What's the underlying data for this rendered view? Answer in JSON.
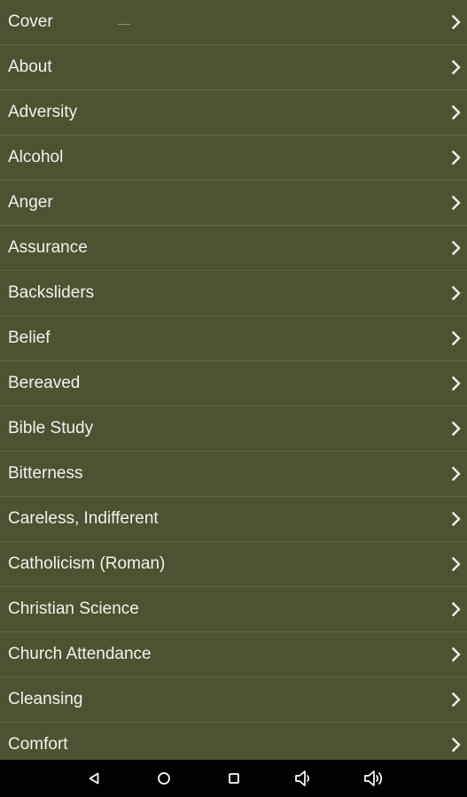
{
  "topics": [
    {
      "label": "Cover"
    },
    {
      "label": "About"
    },
    {
      "label": "Adversity"
    },
    {
      "label": "Alcohol"
    },
    {
      "label": "Anger"
    },
    {
      "label": "Assurance"
    },
    {
      "label": "Backsliders"
    },
    {
      "label": "Belief"
    },
    {
      "label": "Bereaved"
    },
    {
      "label": "Bible Study"
    },
    {
      "label": "Bitterness"
    },
    {
      "label": "Careless, Indifferent"
    },
    {
      "label": "Catholicism (Roman)"
    },
    {
      "label": "Christian Science"
    },
    {
      "label": "Church Attendance"
    },
    {
      "label": "Cleansing"
    },
    {
      "label": "Comfort"
    }
  ],
  "row_icon": "chevron-right-icon",
  "nav_bar": {
    "buttons": [
      {
        "icon": "back-triangle-icon"
      },
      {
        "icon": "home-circle-icon"
      },
      {
        "icon": "recents-square-icon"
      },
      {
        "icon": "volume-down-icon"
      },
      {
        "icon": "volume-up-icon"
      }
    ]
  },
  "colors": {
    "background": "#4f5232",
    "divider": "#62664a",
    "text": "#f2f2ee",
    "nav_bar": "#000000",
    "nav_icon": "#ffffff"
  }
}
